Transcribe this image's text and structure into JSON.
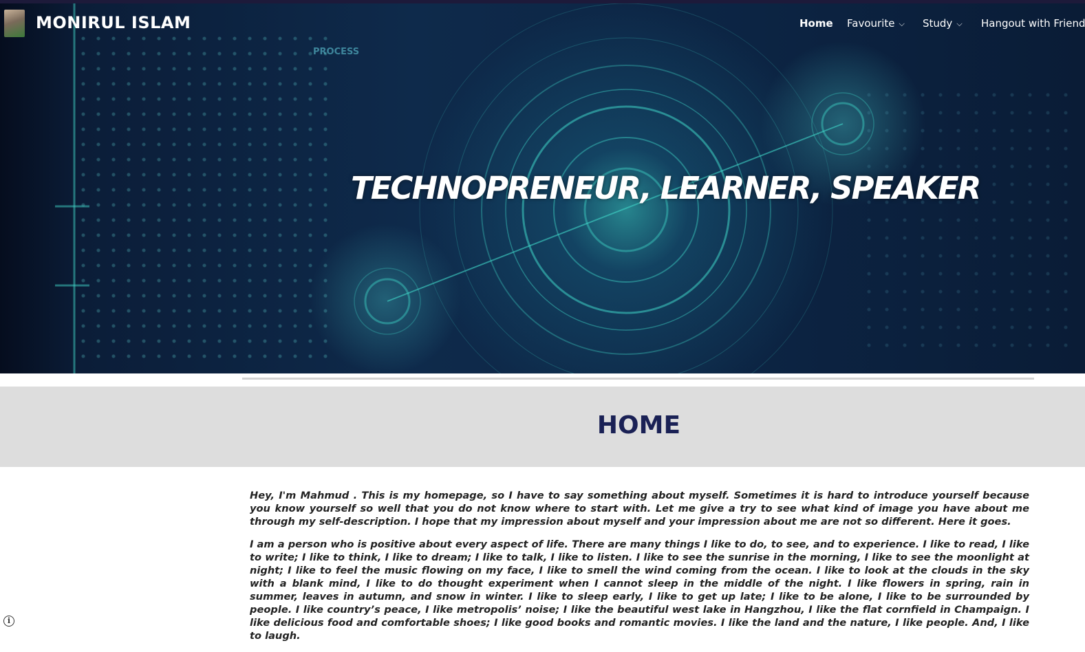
{
  "header": {
    "site_title": "MONIRUL ISLAM",
    "nav": [
      {
        "label": "Home",
        "active": true
      },
      {
        "label": "Favourite",
        "has_dropdown": true
      },
      {
        "label": "Study",
        "has_dropdown": true
      },
      {
        "label": "Hangout with Friends"
      }
    ]
  },
  "hero": {
    "tagline": "TECHNOPRENEUR, LEARNER, SPEAKER",
    "decor_label": "PROCESS"
  },
  "page": {
    "title": "HOME"
  },
  "content": {
    "paragraphs": [
      "Hey, I'm Mahmud . This is my homepage, so I have to say something about myself. Sometimes it is hard to introduce yourself because you know yourself so well that you do not know where to start with. Let me give a try to see what kind of image you have about me through my self-description. I hope that my impression about myself and your impression about me are not so different. Here it goes.",
      "I am a person who is positive about every aspect of life. There are many things I like to do, to see, and to experience. I like to read, I like to write; I like to think, I like to dream; I like to talk, I like to listen. I like to see the sunrise in the morning, I like to see the moonlight at night; I like to feel the music flowing on my face, I like to smell the wind coming from the ocean. I like to look at the clouds in the sky with a blank mind, I like to do thought experiment when I cannot sleep in the middle of the night. I like flowers in spring, rain in summer, leaves in autumn, and snow in winter. I like to sleep early, I like to get up late; I like to be alone, I like to be surrounded by people. I like country’s peace, I like metropolis’ noise; I like the beautiful west lake in Hangzhou, I like the flat cornfield in Champaign. I like delicious food and comfortable shoes; I like good books and romantic movies. I like the land and the nature, I like people. And, I like to laugh."
    ]
  },
  "colors": {
    "title_color": "#1a2155",
    "band_bg": "#dddddd",
    "hero_bg": "#0c2443"
  },
  "icons": {
    "info": "info-icon",
    "dropdown": "chevron-down-icon"
  }
}
